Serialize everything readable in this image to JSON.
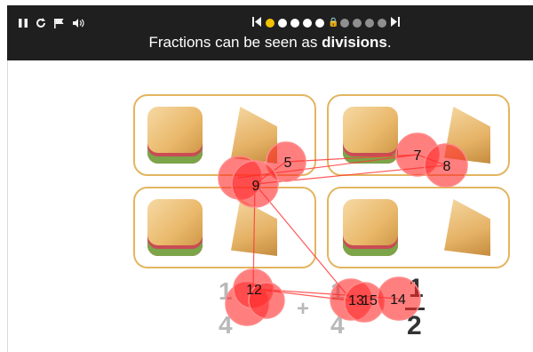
{
  "toolbar": {
    "pause_icon": "pause-icon",
    "replay_icon": "replay-icon",
    "flag_icon": "flag-icon",
    "sound_icon": "sound-icon"
  },
  "pager": {
    "prev_icon": "skip-back-icon",
    "next_icon": "skip-forward-icon",
    "dots": [
      "active",
      "done",
      "done",
      "done",
      "done",
      "locked",
      "future",
      "future",
      "future",
      "future"
    ],
    "lock_glyph": "🔒"
  },
  "banner": {
    "text_before": "Fractions can be seen as ",
    "text_bold": "divisions",
    "text_after": "."
  },
  "formula": {
    "left_numerator": "1",
    "left_denominator": "4",
    "plus": "+",
    "right_numerator": "1",
    "right_denominator": "4",
    "result_numerator": "1",
    "result_denominator": "2"
  },
  "fixations": [
    {
      "label": "5"
    },
    {
      "label": "7"
    },
    {
      "label": "8"
    },
    {
      "label": "9"
    },
    {
      "label": "12"
    },
    {
      "label": "13"
    },
    {
      "label": "15"
    },
    {
      "label": "14"
    }
  ],
  "colors": {
    "banner_bg": "#1f1f1f",
    "card_border": "#e3b560",
    "fixation": "#ff2a2a",
    "active_dot": "#f2c200"
  }
}
